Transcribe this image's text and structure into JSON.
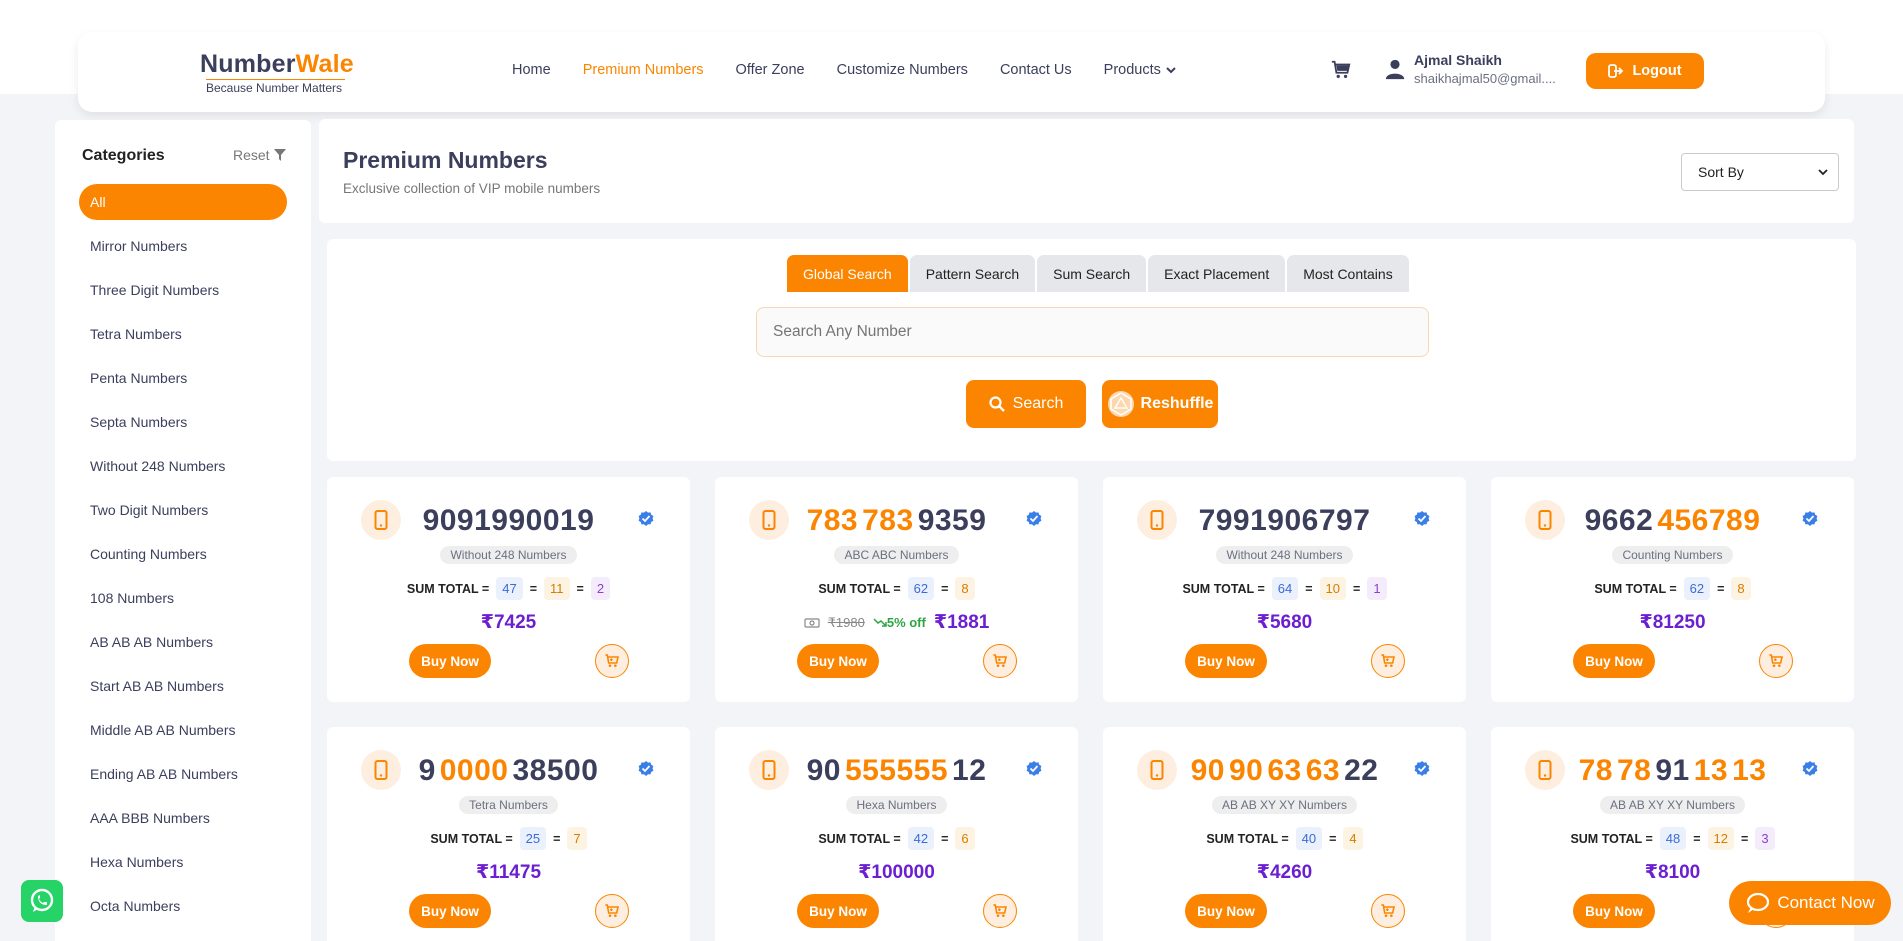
{
  "header": {
    "logo_part1": "Number",
    "logo_part2": "Wale",
    "tagline": "Because Number Matters",
    "nav": [
      "Home",
      "Premium Numbers",
      "Offer Zone",
      "Customize Numbers",
      "Contact Us",
      "Products"
    ],
    "active_nav": "Premium Numbers",
    "user_name": "Ajmal Shaikh",
    "user_email": "shaikhajmal50@gmail....",
    "logout_label": "Logout"
  },
  "sidebar": {
    "title": "Categories",
    "reset_label": "Reset",
    "items": [
      "All",
      "Mirror Numbers",
      "Three Digit Numbers",
      "Tetra Numbers",
      "Penta Numbers",
      "Septa Numbers",
      "Without 248 Numbers",
      "Two Digit Numbers",
      "Counting Numbers",
      "108 Numbers",
      "AB AB AB Numbers",
      "Start AB AB Numbers",
      "Middle AB AB Numbers",
      "Ending AB AB Numbers",
      "AAA BBB Numbers",
      "Hexa Numbers",
      "Octa Numbers"
    ],
    "active_item": "All"
  },
  "main": {
    "title": "Premium Numbers",
    "subtitle": "Exclusive collection of VIP mobile numbers",
    "sort_label": "Sort By"
  },
  "search": {
    "tabs": [
      "Global Search",
      "Pattern Search",
      "Sum Search",
      "Exact Placement",
      "Most Contains"
    ],
    "active_tab": "Global Search",
    "placeholder": "Search Any Number",
    "search_label": "Search",
    "reshuffle_label": "Reshuffle"
  },
  "sum_label": "SUM TOTAL =",
  "buy_label": "Buy Now",
  "currency": "₹",
  "cards": [
    {
      "segments": [
        [
          "9091990019",
          false
        ]
      ],
      "category": "Without 248 Numbers",
      "sums": [
        "47",
        "11",
        "2"
      ],
      "price": "7425"
    },
    {
      "segments": [
        [
          "783",
          true
        ],
        [
          "783",
          true
        ],
        [
          "9359",
          false
        ]
      ],
      "category": "ABC ABC Numbers",
      "sums": [
        "62",
        "8"
      ],
      "old_price": "₹1980",
      "discount": "5% off",
      "price": "1881"
    },
    {
      "segments": [
        [
          "7991906797",
          false
        ]
      ],
      "category": "Without 248 Numbers",
      "sums": [
        "64",
        "10",
        "1"
      ],
      "price": "5680"
    },
    {
      "segments": [
        [
          "9662",
          false
        ],
        [
          "456789",
          true
        ]
      ],
      "category": "Counting Numbers",
      "sums": [
        "62",
        "8"
      ],
      "price": "81250"
    },
    {
      "segments": [
        [
          "9",
          false
        ],
        [
          "0000",
          true
        ],
        [
          "38500",
          false
        ]
      ],
      "category": "Tetra Numbers",
      "sums": [
        "25",
        "7"
      ],
      "price": "11475"
    },
    {
      "segments": [
        [
          "90",
          false
        ],
        [
          "555555",
          true
        ],
        [
          "12",
          false
        ]
      ],
      "category": "Hexa Numbers",
      "sums": [
        "42",
        "6"
      ],
      "price": "100000"
    },
    {
      "segments": [
        [
          "90",
          true
        ],
        [
          "90",
          true
        ],
        [
          "63",
          true
        ],
        [
          "63",
          true
        ],
        [
          "22",
          false
        ]
      ],
      "category": "AB AB XY XY Numbers",
      "sums": [
        "40",
        "4"
      ],
      "price": "4260"
    },
    {
      "segments": [
        [
          "78",
          true
        ],
        [
          "78",
          true
        ],
        [
          "91",
          false
        ],
        [
          "13",
          true
        ],
        [
          "13",
          true
        ]
      ],
      "category": "AB AB XY XY Numbers",
      "sums": [
        "48",
        "12",
        "3"
      ],
      "price": "8100"
    }
  ],
  "contact_label": "Contact Now",
  "colors": {
    "accent": "#fb8500",
    "price": "#6b1fd0",
    "text": "#3b3f5c"
  }
}
